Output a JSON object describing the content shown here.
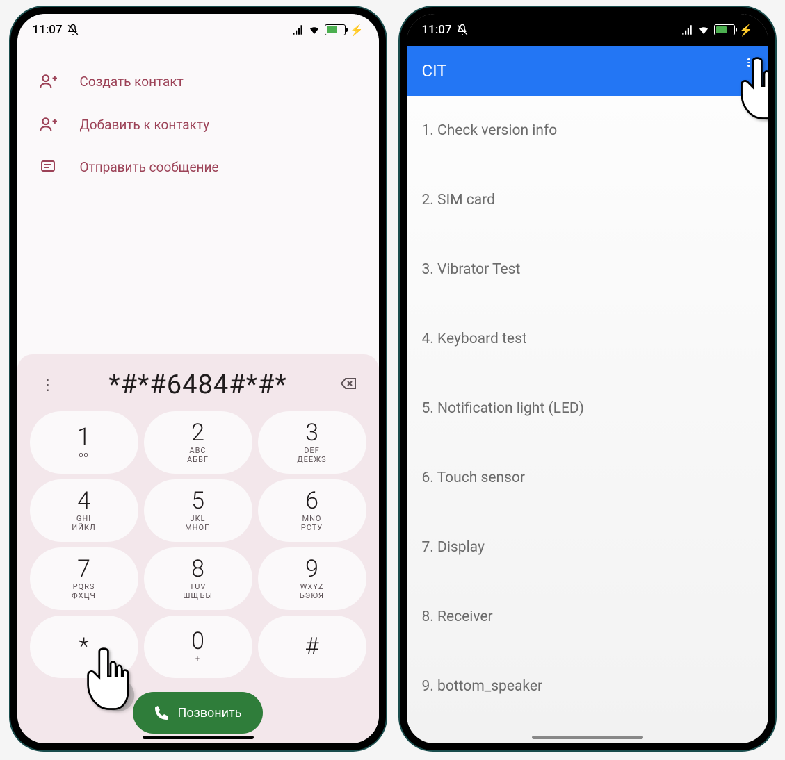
{
  "status": {
    "time": "11:07",
    "battery_text": "64"
  },
  "dialer": {
    "actions": {
      "create": "Создать контакт",
      "add": "Добавить к контакту",
      "message": "Отправить сообщение"
    },
    "number": "*#*#6484#*#*",
    "keys": [
      {
        "d": "1",
        "l": "ᴏᴏ"
      },
      {
        "d": "2",
        "l": "ABC\nАБВГ"
      },
      {
        "d": "3",
        "l": "DEF\nДЕЕЖЗ"
      },
      {
        "d": "4",
        "l": "GHI\nИЙКЛ"
      },
      {
        "d": "5",
        "l": "JKL\nМНОП"
      },
      {
        "d": "6",
        "l": "MNO\nРСТУ"
      },
      {
        "d": "7",
        "l": "PQRS\nФХЦЧ"
      },
      {
        "d": "8",
        "l": "TUV\nШЩЪЫ"
      },
      {
        "d": "9",
        "l": "WXYZ\nЬЭЮЯ"
      },
      {
        "d": "*",
        "l": ""
      },
      {
        "d": "0",
        "l": "+"
      },
      {
        "d": "#",
        "l": ""
      }
    ],
    "call_label": "Позвонить"
  },
  "cit": {
    "title": "CIT",
    "items": [
      "1. Check version info",
      "2. SIM card",
      "3. Vibrator Test",
      "4. Keyboard test",
      "5. Notification light (LED)",
      "6. Touch sensor",
      "7. Display",
      "8. Receiver",
      "9. bottom_speaker"
    ]
  }
}
